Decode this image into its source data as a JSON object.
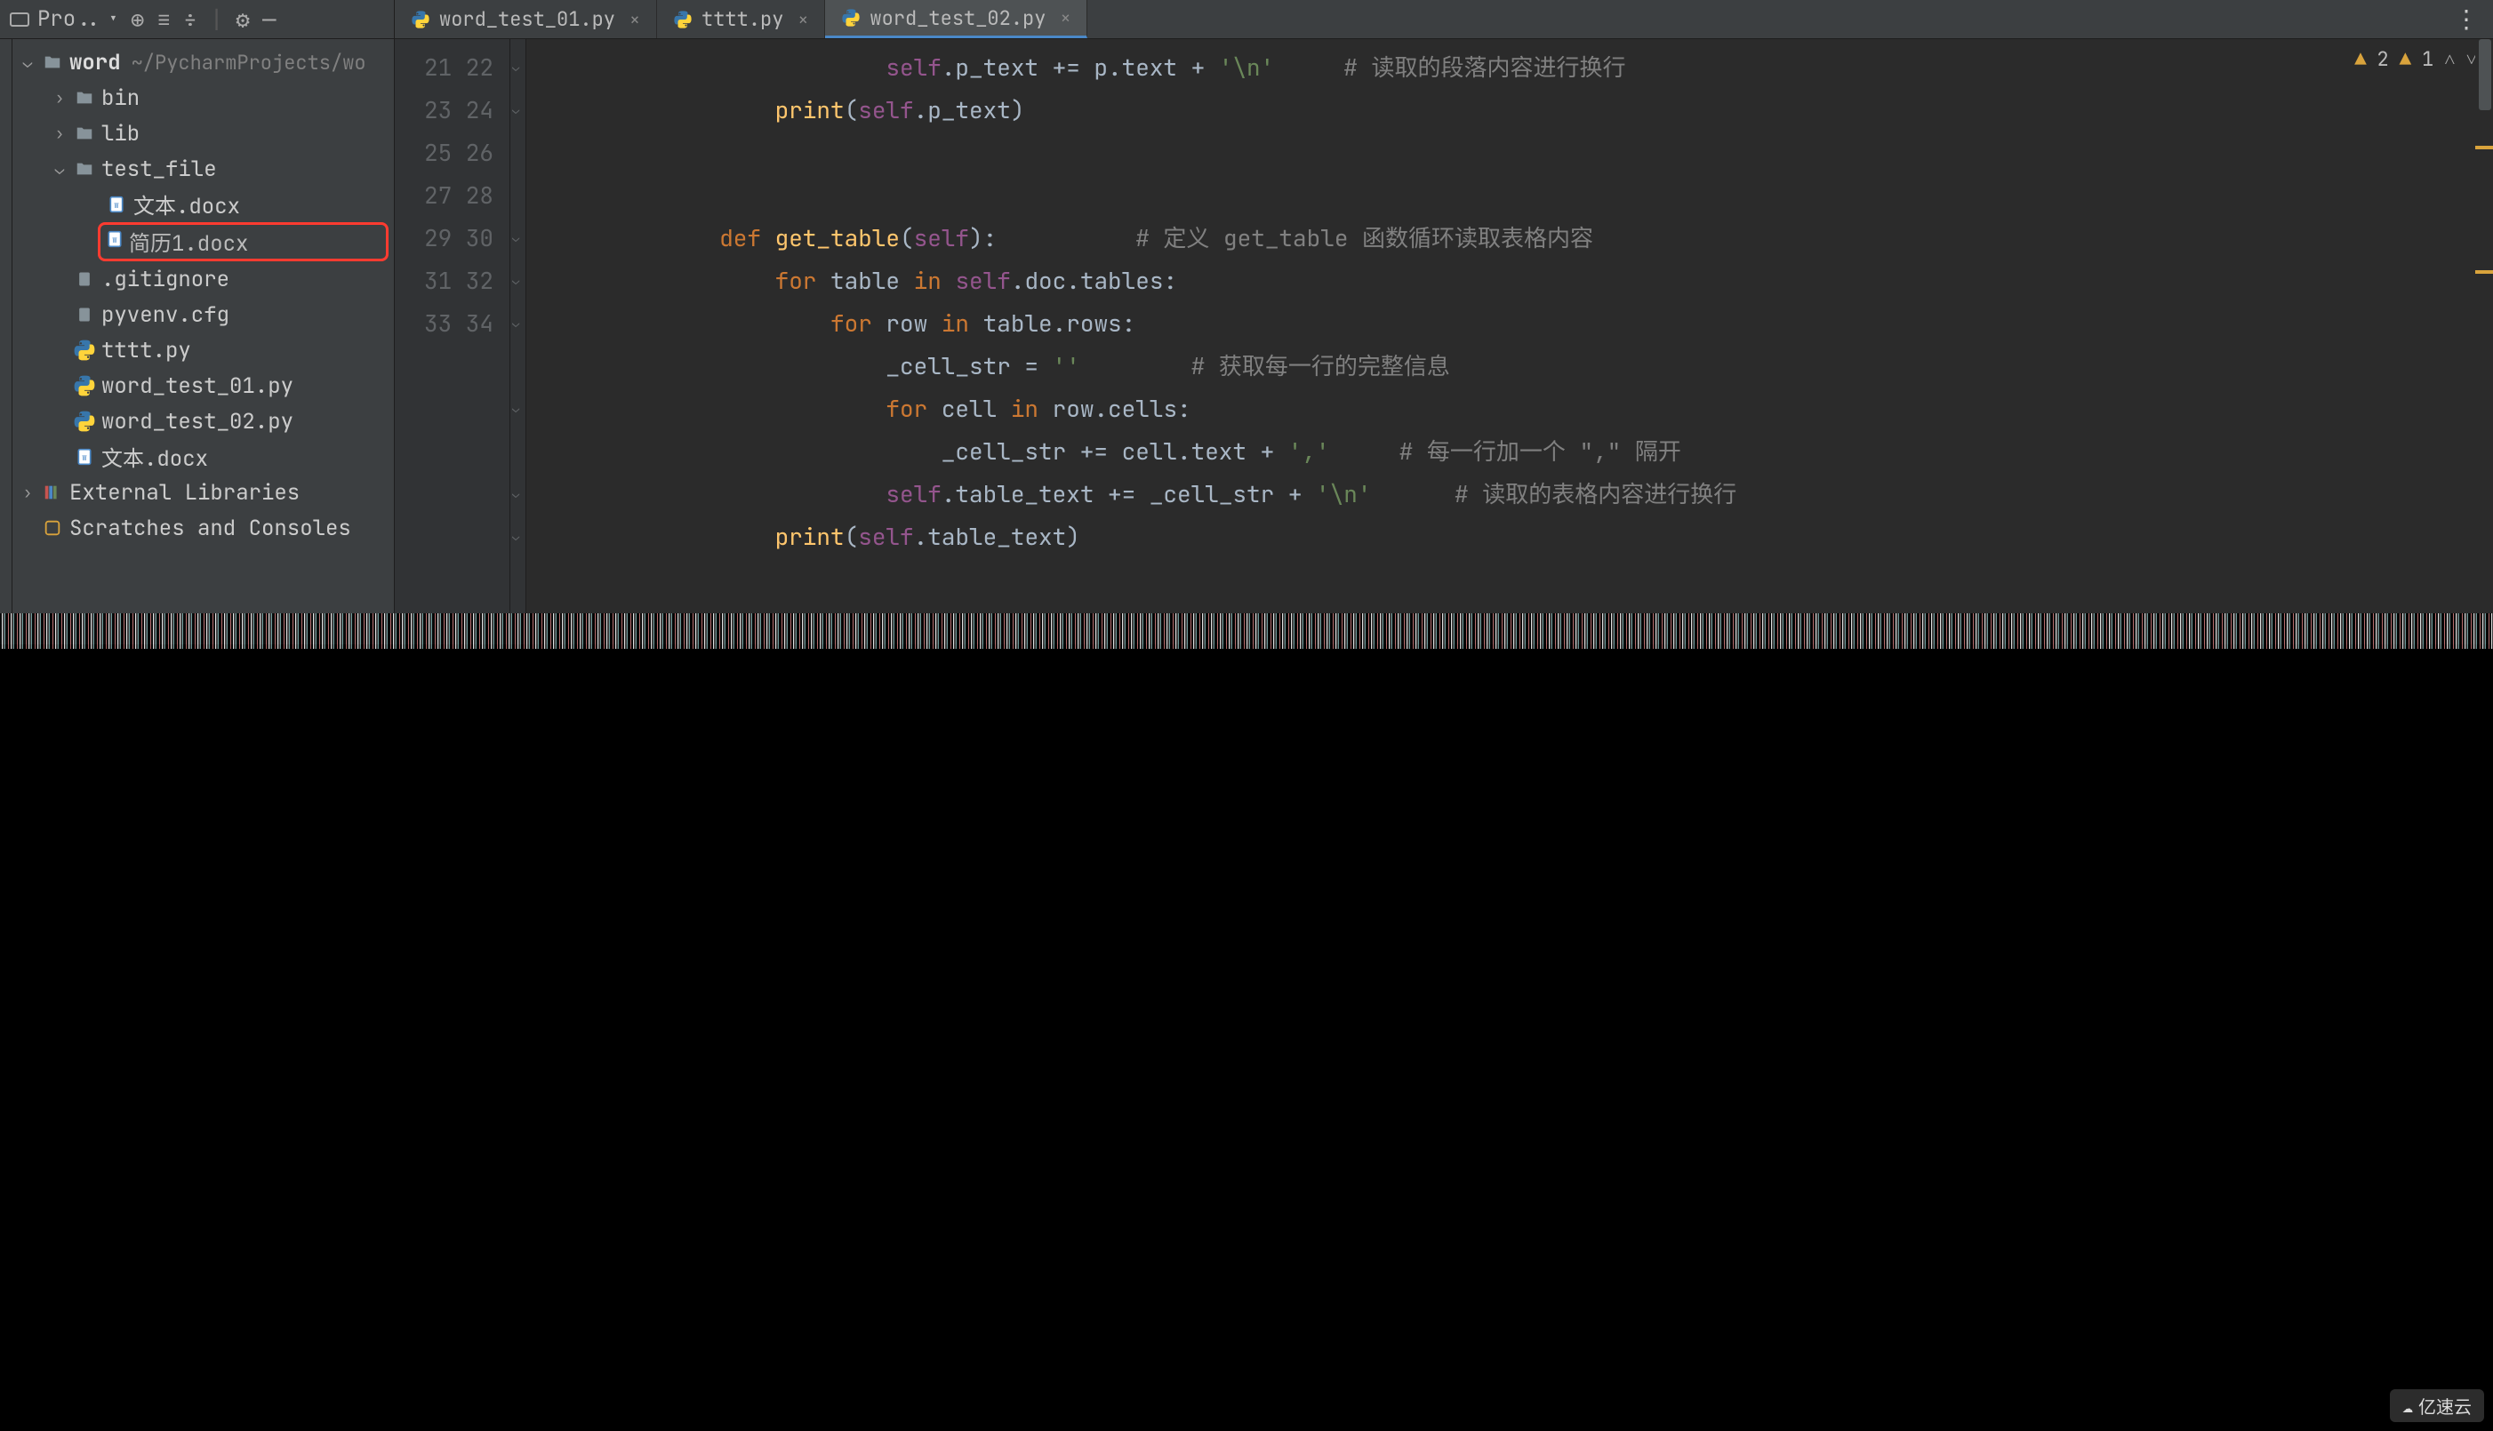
{
  "toolbar": {
    "project_label": "Pro..",
    "icons": [
      "target",
      "expand",
      "collapse",
      "divider",
      "gear",
      "minimize"
    ]
  },
  "tabs": [
    {
      "label": "word_test_01.py",
      "active": false
    },
    {
      "label": "tttt.py",
      "active": false
    },
    {
      "label": "word_test_02.py",
      "active": true
    }
  ],
  "tree": {
    "root": {
      "label": "word",
      "path": "~/PycharmProjects/wo"
    },
    "items": [
      {
        "type": "folder",
        "label": "bin",
        "depth": 1,
        "expandable": true
      },
      {
        "type": "folder",
        "label": "lib",
        "depth": 1,
        "expandable": true
      },
      {
        "type": "folder",
        "label": "test_file",
        "depth": 1,
        "expandable": true,
        "expanded": true
      },
      {
        "type": "docx",
        "label": "文本.docx",
        "depth": 2
      },
      {
        "type": "docx",
        "label": "简历1.docx",
        "depth": 2,
        "highlighted": true
      },
      {
        "type": "file",
        "label": ".gitignore",
        "depth": 1
      },
      {
        "type": "file",
        "label": "pyvenv.cfg",
        "depth": 1
      },
      {
        "type": "py",
        "label": "tttt.py",
        "depth": 1
      },
      {
        "type": "py",
        "label": "word_test_01.py",
        "depth": 1
      },
      {
        "type": "py",
        "label": "word_test_02.py",
        "depth": 1
      },
      {
        "type": "docx",
        "label": "文本.docx",
        "depth": 1
      }
    ],
    "external": "External Libraries",
    "scratches": "Scratches and Consoles"
  },
  "inspections": {
    "warn1": "2",
    "warn2": "1"
  },
  "gutter_start": 21,
  "gutter_end": 34,
  "code_lines": [
    {
      "indent": 4,
      "tokens": [
        [
          "self",
          "self"
        ],
        [
          "",
          ".p_text += p.text + "
        ],
        [
          "str",
          "'\\n'"
        ],
        [
          "",
          "     "
        ],
        [
          "cm",
          "# 读取的段落内容进行换行"
        ]
      ]
    },
    {
      "indent": 2,
      "tokens": [
        [
          "fn",
          "print"
        ],
        [
          "",
          "("
        ],
        [
          "self",
          "self"
        ],
        [
          "",
          ".p_text)"
        ]
      ]
    },
    {
      "indent": 0,
      "tokens": [
        [
          "",
          ""
        ]
      ]
    },
    {
      "indent": 0,
      "tokens": [
        [
          "",
          ""
        ]
      ]
    },
    {
      "indent": 1,
      "tokens": [
        [
          "kw",
          "def "
        ],
        [
          "fn",
          "get_table"
        ],
        [
          "",
          "("
        ],
        [
          "self",
          "self"
        ],
        [
          "",
          "):          "
        ],
        [
          "cm",
          "# 定义 get_table 函数循环读取表格内容"
        ]
      ]
    },
    {
      "indent": 2,
      "tokens": [
        [
          "kw",
          "for "
        ],
        [
          "",
          "table "
        ],
        [
          "kw",
          "in "
        ],
        [
          "self",
          "self"
        ],
        [
          "",
          ".doc.tables:"
        ]
      ]
    },
    {
      "indent": 3,
      "tokens": [
        [
          "kw",
          "for "
        ],
        [
          "",
          "row "
        ],
        [
          "kw",
          "in "
        ],
        [
          "",
          "table.rows:"
        ]
      ]
    },
    {
      "indent": 4,
      "tokens": [
        [
          "",
          "_cell_str = "
        ],
        [
          "str",
          "''"
        ],
        [
          "",
          "        "
        ],
        [
          "cm",
          "# 获取每一行的完整信息"
        ]
      ]
    },
    {
      "indent": 4,
      "tokens": [
        [
          "kw",
          "for "
        ],
        [
          "",
          "cell "
        ],
        [
          "kw",
          "in "
        ],
        [
          "",
          "row.cells:"
        ]
      ]
    },
    {
      "indent": 5,
      "tokens": [
        [
          "",
          "_cell_str += cell.text + "
        ],
        [
          "str",
          "','"
        ],
        [
          "",
          "     "
        ],
        [
          "cm",
          "# 每一行加一个 \",\" 隔开"
        ]
      ]
    },
    {
      "indent": 4,
      "tokens": [
        [
          "self",
          "self"
        ],
        [
          "",
          ".table_text += _cell_str + "
        ],
        [
          "str",
          "'\\n'"
        ],
        [
          "",
          "      "
        ],
        [
          "cm",
          "# 读取的表格内容进行换行"
        ]
      ]
    },
    {
      "indent": 2,
      "tokens": [
        [
          "fn",
          "print"
        ],
        [
          "",
          "("
        ],
        [
          "self",
          "self"
        ],
        [
          "",
          ".table_text)"
        ]
      ]
    },
    {
      "indent": 0,
      "tokens": [
        [
          "",
          ""
        ]
      ]
    },
    {
      "indent": 0,
      "tokens": [
        [
          "",
          ""
        ]
      ]
    }
  ],
  "watermark": "亿速云"
}
